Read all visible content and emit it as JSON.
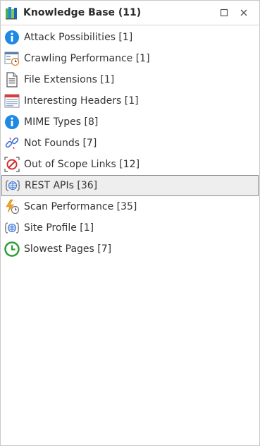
{
  "panel": {
    "title": "Knowledge Base (11)",
    "title_icon": "books-icon",
    "controls": [
      "maximize-icon",
      "close-icon"
    ]
  },
  "items": [
    {
      "label": "Attack Possibilities [1]",
      "icon": "info-icon"
    },
    {
      "label": "Crawling Performance [1]",
      "icon": "window-clock-icon"
    },
    {
      "label": "File Extensions [1]",
      "icon": "document-icon"
    },
    {
      "label": "Interesting Headers [1]",
      "icon": "header-window-icon"
    },
    {
      "label": "MIME Types [8]",
      "icon": "info-icon"
    },
    {
      "label": "Not Founds [7]",
      "icon": "broken-link-icon"
    },
    {
      "label": "Out of Scope Links [12]",
      "icon": "no-entry-icon"
    },
    {
      "label": "REST APIs [36]",
      "icon": "globe-braces-icon",
      "selected": true
    },
    {
      "label": "Scan Performance [35]",
      "icon": "lightning-clock-icon"
    },
    {
      "label": "Site Profile [1]",
      "icon": "globe-braces-icon"
    },
    {
      "label": "Slowest Pages [7]",
      "icon": "green-clock-icon"
    }
  ],
  "colors": {
    "info_blue": "#1e88e5",
    "no_entry_red": "#d32f2f",
    "clock_green": "#2e9e3a",
    "lightning_orange": "#f5a623",
    "selected_bg": "#eeeeee",
    "selected_border": "#8a8a8a"
  }
}
